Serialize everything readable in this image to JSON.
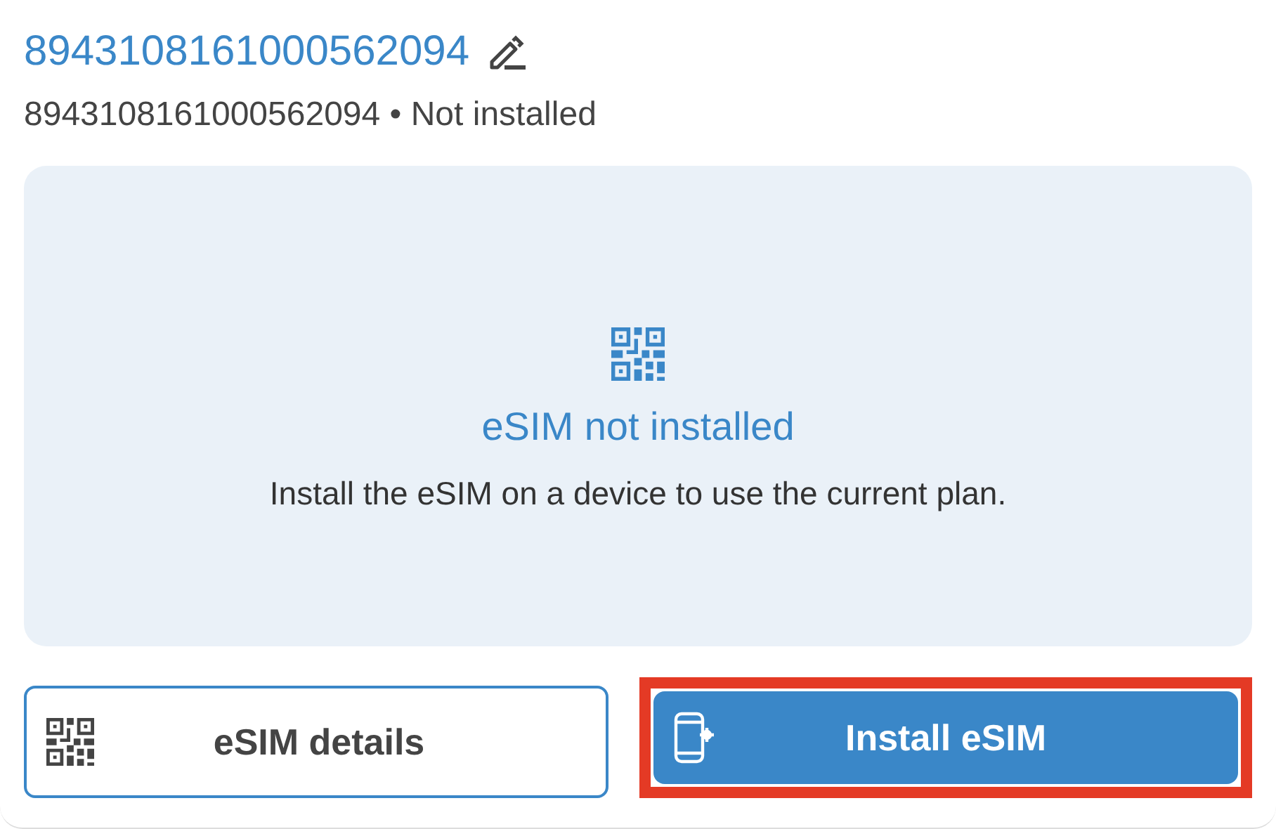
{
  "header": {
    "title": "8943108161000562094",
    "subtitle": "8943108161000562094 • Not installed"
  },
  "status_panel": {
    "title": "eSIM not installed",
    "message": "Install the eSIM on a device to use the current plan."
  },
  "actions": [
    {
      "label": "eSIM details",
      "kind": "outline",
      "highlighted": false
    },
    {
      "label": "Install eSIM",
      "kind": "primary",
      "highlighted": true
    }
  ]
}
